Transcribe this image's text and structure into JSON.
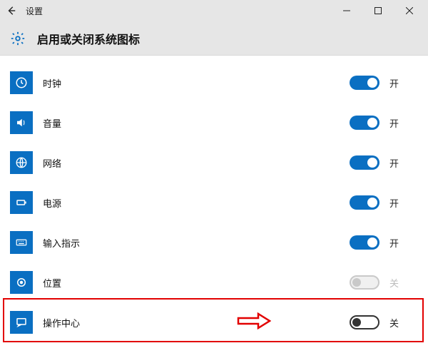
{
  "window": {
    "title": "设置"
  },
  "header": {
    "title": "启用或关闭系统图标"
  },
  "labels": {
    "on": "开",
    "off": "关"
  },
  "rows": [
    {
      "key": "clock",
      "label": "时钟",
      "state": "on",
      "icon": "clock-icon"
    },
    {
      "key": "volume",
      "label": "音量",
      "state": "on",
      "icon": "volume-icon"
    },
    {
      "key": "network",
      "label": "网络",
      "state": "on",
      "icon": "network-icon"
    },
    {
      "key": "power",
      "label": "电源",
      "state": "on",
      "icon": "power-icon"
    },
    {
      "key": "input",
      "label": "输入指示",
      "state": "on",
      "icon": "keyboard-icon"
    },
    {
      "key": "location",
      "label": "位置",
      "state": "disabled",
      "icon": "location-icon"
    },
    {
      "key": "actioncenter",
      "label": "操作中心",
      "state": "off",
      "icon": "action-center-icon"
    }
  ],
  "colors": {
    "accent": "#0a6fc2",
    "annotation": "#e20000"
  }
}
